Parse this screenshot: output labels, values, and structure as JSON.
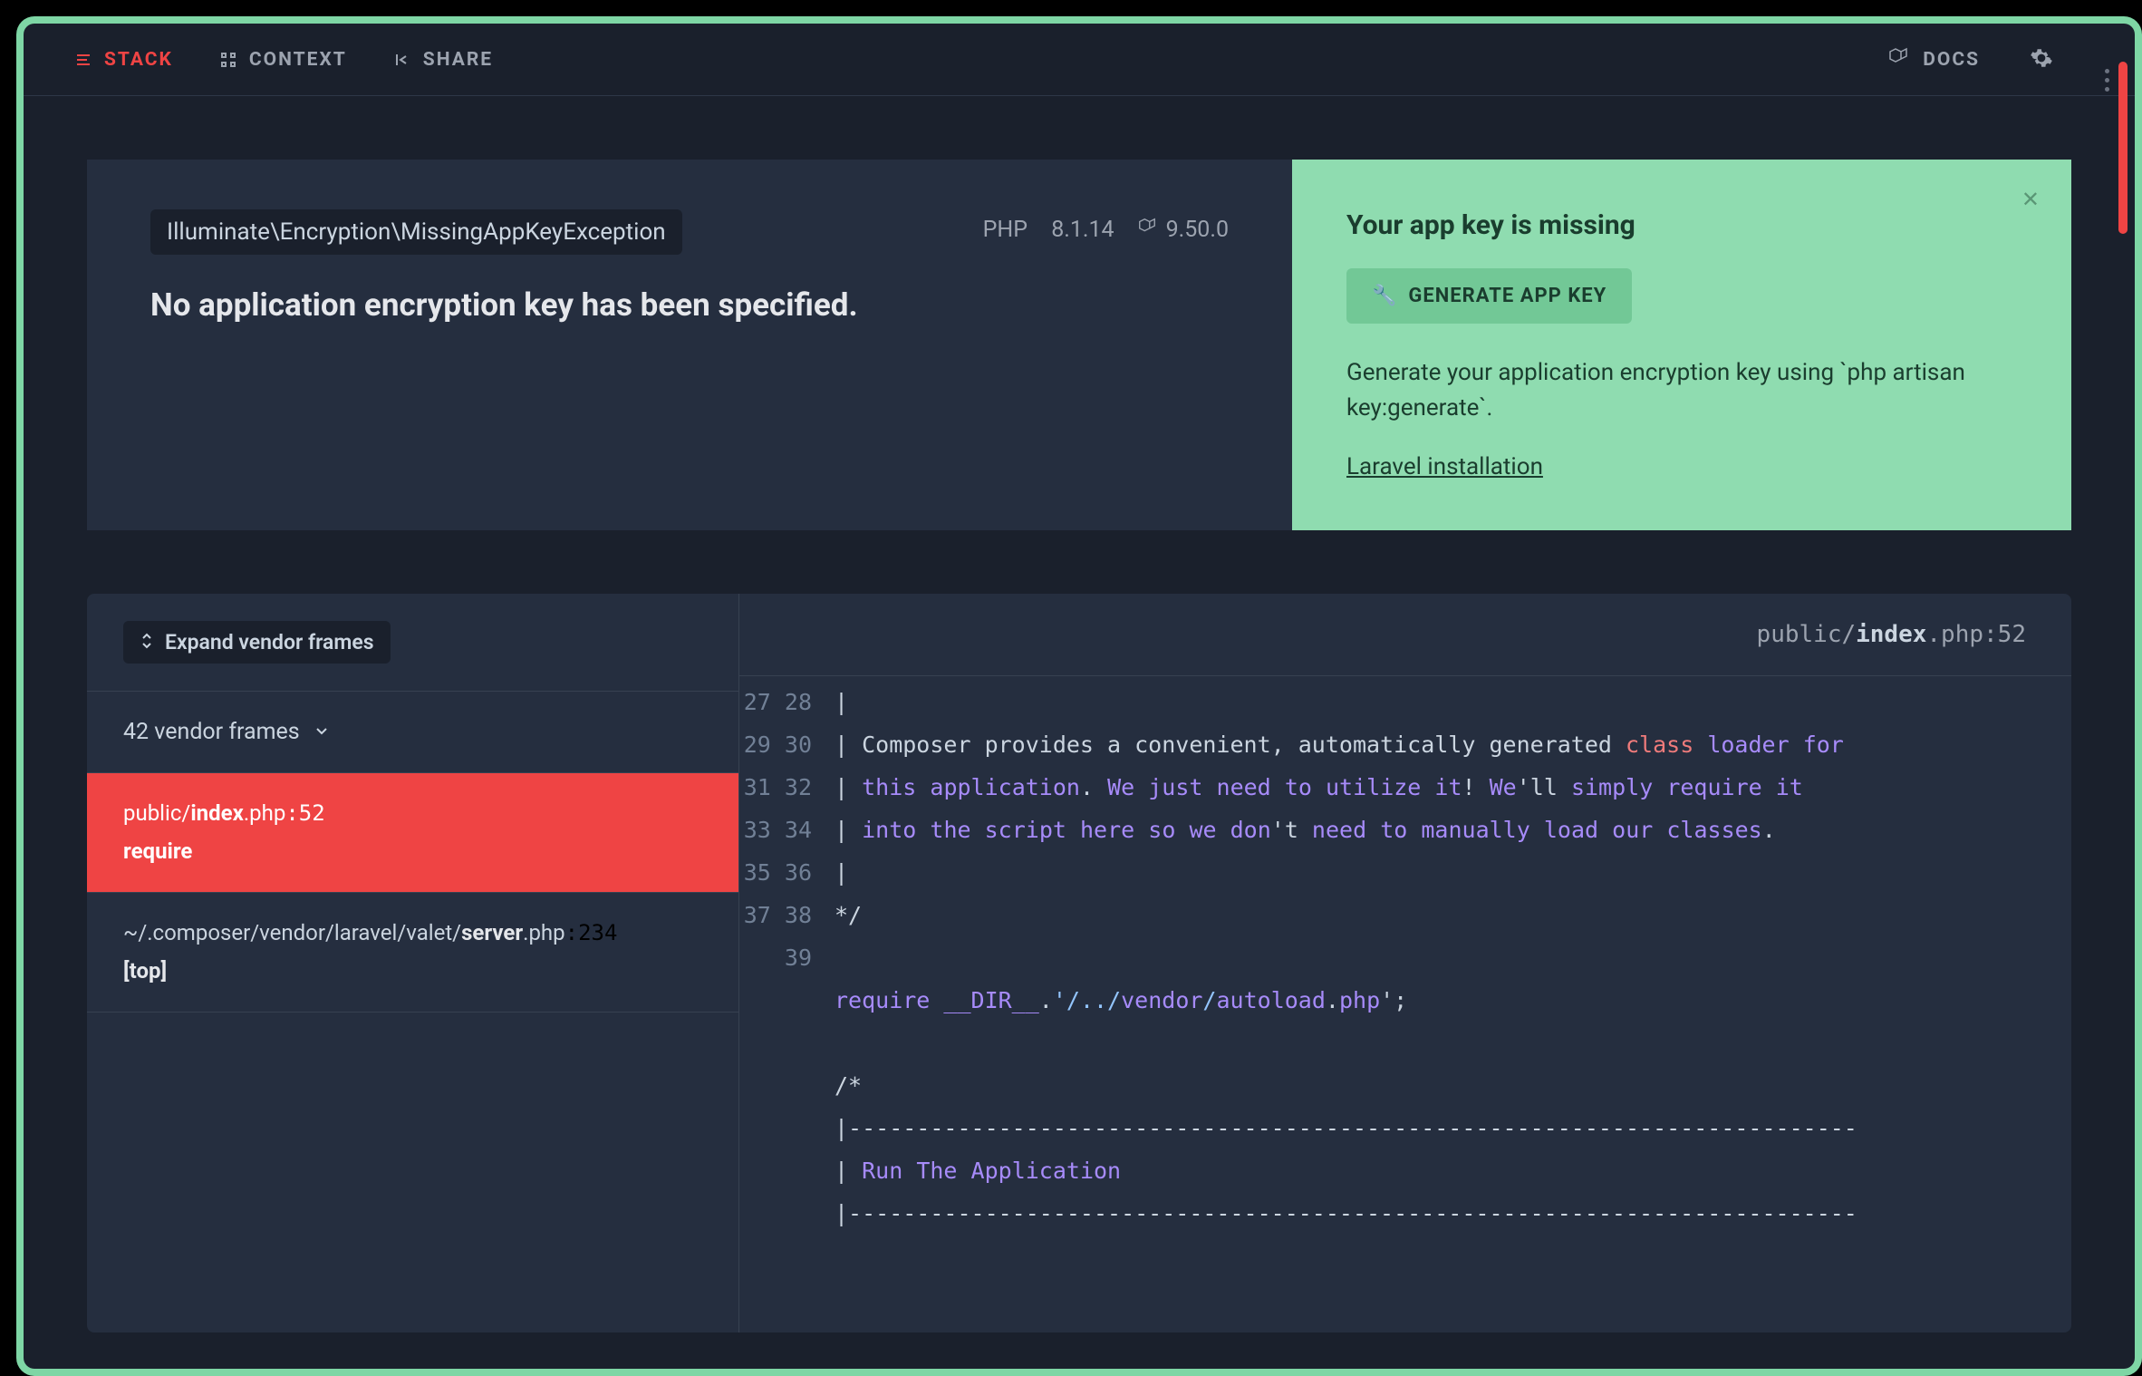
{
  "topbar": {
    "tabs": [
      {
        "label": "STACK"
      },
      {
        "label": "CONTEXT"
      },
      {
        "label": "SHARE"
      }
    ],
    "docs": "DOCS"
  },
  "hero": {
    "exception": "Illuminate\\Encryption\\MissingAppKeyException",
    "php_label": "PHP",
    "php_version": "8.1.14",
    "laravel_version": "9.50.0",
    "title": "No application encryption key has been specified."
  },
  "solution": {
    "title": "Your app key is missing",
    "button": "GENERATE APP KEY",
    "description": "Generate your application encryption key using `php artisan key:generate`.",
    "link": "Laravel installation"
  },
  "stack": {
    "expand_label": "Expand vendor frames",
    "vendor_count": "42 vendor frames",
    "frames": [
      {
        "path_prefix": "public/",
        "file": "index",
        "ext": ".php",
        "line": ":52",
        "func": "require"
      },
      {
        "path_prefix": "~/.composer/vendor/laravel/valet/",
        "file": "server",
        "ext": ".php",
        "line": ":234",
        "func": "[top]"
      }
    ],
    "header": {
      "path_prefix": "public/",
      "file": "index",
      "ext": ".php",
      "line": ":52"
    }
  },
  "code": {
    "start": 27,
    "lines": [
      {
        "n": 27,
        "segs": [
          {
            "t": "|",
            "c": "comment"
          }
        ]
      },
      {
        "n": 28,
        "segs": [
          {
            "t": "| Composer provides a convenient, automatically generated ",
            "c": "comment"
          },
          {
            "t": "class",
            "c": "key"
          },
          {
            "t": " ",
            "c": "comment"
          },
          {
            "t": "loader",
            "c": "kw"
          },
          {
            "t": " ",
            "c": "comment"
          },
          {
            "t": "for",
            "c": "kw"
          }
        ]
      },
      {
        "n": 29,
        "segs": [
          {
            "t": "| ",
            "c": "comment"
          },
          {
            "t": "this",
            "c": "kw"
          },
          {
            "t": " ",
            "c": "comment"
          },
          {
            "t": "application",
            "c": "kw"
          },
          {
            "t": ". ",
            "c": "comment"
          },
          {
            "t": "We",
            "c": "kw"
          },
          {
            "t": " ",
            "c": "comment"
          },
          {
            "t": "just",
            "c": "kw"
          },
          {
            "t": " ",
            "c": "comment"
          },
          {
            "t": "need",
            "c": "kw"
          },
          {
            "t": " ",
            "c": "comment"
          },
          {
            "t": "to",
            "c": "kw"
          },
          {
            "t": " ",
            "c": "comment"
          },
          {
            "t": "utilize",
            "c": "kw"
          },
          {
            "t": " ",
            "c": "comment"
          },
          {
            "t": "it",
            "c": "kw"
          },
          {
            "t": "! ",
            "c": "comment"
          },
          {
            "t": "We",
            "c": "kw"
          },
          {
            "t": "'ll ",
            "c": "comment"
          },
          {
            "t": "simply",
            "c": "kw"
          },
          {
            "t": " ",
            "c": "comment"
          },
          {
            "t": "require",
            "c": "kw"
          },
          {
            "t": " ",
            "c": "comment"
          },
          {
            "t": "it",
            "c": "kw"
          }
        ]
      },
      {
        "n": 30,
        "segs": [
          {
            "t": "| ",
            "c": "comment"
          },
          {
            "t": "into",
            "c": "kw"
          },
          {
            "t": " ",
            "c": "comment"
          },
          {
            "t": "the",
            "c": "kw"
          },
          {
            "t": " ",
            "c": "comment"
          },
          {
            "t": "script",
            "c": "kw"
          },
          {
            "t": " ",
            "c": "comment"
          },
          {
            "t": "here",
            "c": "kw"
          },
          {
            "t": " ",
            "c": "comment"
          },
          {
            "t": "so",
            "c": "kw"
          },
          {
            "t": " ",
            "c": "comment"
          },
          {
            "t": "we",
            "c": "kw"
          },
          {
            "t": " ",
            "c": "comment"
          },
          {
            "t": "don",
            "c": "kw"
          },
          {
            "t": "'t ",
            "c": "comment"
          },
          {
            "t": "need",
            "c": "kw"
          },
          {
            "t": " ",
            "c": "comment"
          },
          {
            "t": "to",
            "c": "kw"
          },
          {
            "t": " ",
            "c": "comment"
          },
          {
            "t": "manually",
            "c": "kw"
          },
          {
            "t": " ",
            "c": "comment"
          },
          {
            "t": "load",
            "c": "kw"
          },
          {
            "t": " ",
            "c": "comment"
          },
          {
            "t": "our",
            "c": "kw"
          },
          {
            "t": " ",
            "c": "comment"
          },
          {
            "t": "classes",
            "c": "kw"
          },
          {
            "t": ".",
            "c": "comment"
          }
        ]
      },
      {
        "n": 31,
        "segs": [
          {
            "t": "|",
            "c": "comment"
          }
        ]
      },
      {
        "n": 32,
        "segs": [
          {
            "t": "*/",
            "c": "comment"
          }
        ]
      },
      {
        "n": 33,
        "segs": [
          {
            "t": "",
            "c": "comment"
          }
        ]
      },
      {
        "n": 34,
        "segs": [
          {
            "t": "require",
            "c": "kw"
          },
          {
            "t": " ",
            "c": "comment"
          },
          {
            "t": "__DIR__",
            "c": "func"
          },
          {
            "t": ".",
            "c": "comment"
          },
          {
            "t": "'/../",
            "c": "bluish"
          },
          {
            "t": "vendor",
            "c": "kw"
          },
          {
            "t": "/",
            "c": "bluish"
          },
          {
            "t": "autoload",
            "c": "kw"
          },
          {
            "t": ".",
            "c": "comment"
          },
          {
            "t": "php",
            "c": "kw"
          },
          {
            "t": "';",
            "c": "comment"
          }
        ]
      },
      {
        "n": 35,
        "segs": [
          {
            "t": "",
            "c": "comment"
          }
        ]
      },
      {
        "n": 36,
        "segs": [
          {
            "t": "/*",
            "c": "comment"
          }
        ]
      },
      {
        "n": 37,
        "segs": [
          {
            "t": "|--------------------------------------------------------------------------",
            "c": "comment"
          }
        ]
      },
      {
        "n": 38,
        "segs": [
          {
            "t": "| ",
            "c": "comment"
          },
          {
            "t": "Run",
            "c": "kw"
          },
          {
            "t": " ",
            "c": "comment"
          },
          {
            "t": "The",
            "c": "kw"
          },
          {
            "t": " ",
            "c": "comment"
          },
          {
            "t": "Application",
            "c": "kw"
          }
        ]
      },
      {
        "n": 39,
        "segs": [
          {
            "t": "|--------------------------------------------------------------------------",
            "c": "comment"
          }
        ]
      }
    ]
  }
}
